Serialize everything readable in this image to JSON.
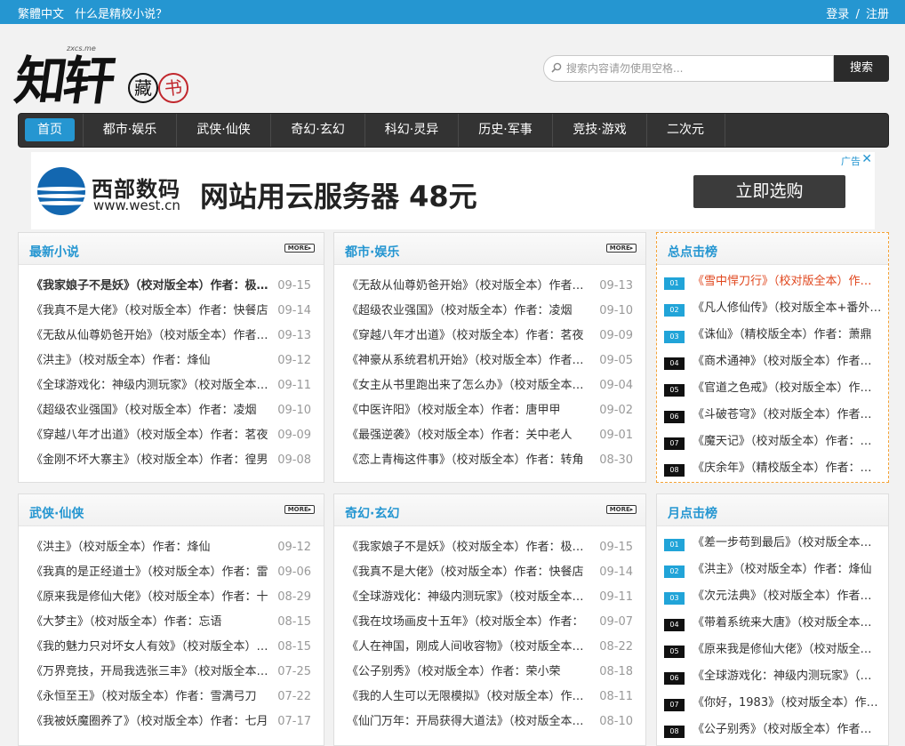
{
  "topbar": {
    "traditional": "繁體中文",
    "about": "什么是精校小说？",
    "login": "登录",
    "slash": "/",
    "register": "注册"
  },
  "logo": {
    "main": "知轩",
    "sub": "zxcs.me",
    "stamp1": "藏",
    "stamp2": "书"
  },
  "search": {
    "placeholder": "搜索内容请勿使用空格...",
    "button": "搜索"
  },
  "nav": [
    "首页",
    "都市·娱乐",
    "武侠·仙侠",
    "奇幻·玄幻",
    "科幻·灵异",
    "历史·军事",
    "竞技·游戏",
    "二次元"
  ],
  "ad": {
    "brand": "西部数码",
    "domain": "www.west.cn",
    "slogan": "网站用云服务器 48元",
    "cta": "立即选购",
    "tag": "广告",
    "close": "✕"
  },
  "more_label": "MORE▸",
  "panels": [
    {
      "title": "最新小说",
      "rows": [
        {
          "t": "《我家娘子不是妖》（校对版全本）作者：极品妖孽",
          "d": "09-15",
          "bold": true
        },
        {
          "t": "《我真不是大佬》（校对版全本）作者：快餐店",
          "d": "09-14"
        },
        {
          "t": "《无敌从仙尊奶爸开始》（校对版全本）作者：雪洛",
          "d": "09-13"
        },
        {
          "t": "《洪主》（校对版全本）作者：烽仙",
          "d": "09-12"
        },
        {
          "t": "《全球游戏化：神级内测玩家》（校对版全本）作者",
          "d": "09-11"
        },
        {
          "t": "《超级农业强国》（校对版全本）作者：凌烟",
          "d": "09-10"
        },
        {
          "t": "《穿越八年才出道》（校对版全本）作者：茗夜",
          "d": "09-09"
        },
        {
          "t": "《金刚不坏大寨主》（校对版全本）作者：徨男",
          "d": "09-08"
        }
      ]
    },
    {
      "title": "都市·娱乐",
      "rows": [
        {
          "t": "《无敌从仙尊奶爸开始》（校对版全本）作者：雪洛",
          "d": "09-13"
        },
        {
          "t": "《超级农业强国》（校对版全本）作者：凌烟",
          "d": "09-10"
        },
        {
          "t": "《穿越八年才出道》（校对版全本）作者：茗夜",
          "d": "09-09"
        },
        {
          "t": "《神豪从系统君机开始》（校对版全本）作者：文",
          "d": "09-05"
        },
        {
          "t": "《女主从书里跑出来了怎么办》（校对版全本）作者",
          "d": "09-04"
        },
        {
          "t": "《中医许阳》（校对版全本）作者：唐甲甲",
          "d": "09-02"
        },
        {
          "t": "《最强逆袭》（校对版全本）作者：关中老人",
          "d": "09-01"
        },
        {
          "t": "《恋上青梅这件事》（校对版全本）作者：转角",
          "d": "08-30"
        }
      ]
    },
    {
      "title": "武侠·仙侠",
      "rows": [
        {
          "t": "《洪主》（校对版全本）作者：烽仙",
          "d": "09-12"
        },
        {
          "t": "《我真的是正经道士》（校对版全本）作者：雷",
          "d": "09-06"
        },
        {
          "t": "《原来我是修仙大佬》（校对版全本）作者：十",
          "d": "08-29"
        },
        {
          "t": "《大梦主》（校对版全本）作者：忘语",
          "d": "08-15"
        },
        {
          "t": "《我的魅力只对坏女人有效》（校对版全本）作者",
          "d": "08-15"
        },
        {
          "t": "《万界竞技，开局我选张三丰》（校对版全本）作者",
          "d": "07-25"
        },
        {
          "t": "《永恒至王》（校对版全本）作者：雪满弓刀",
          "d": "07-22"
        },
        {
          "t": "《我被妖魔圈养了》（校对版全本）作者：七月",
          "d": "07-17"
        }
      ]
    },
    {
      "title": "奇幻·玄幻",
      "rows": [
        {
          "t": "《我家娘子不是妖》（校对版全本）作者：极品妖孽",
          "d": "09-15"
        },
        {
          "t": "《我真不是大佬》（校对版全本）作者：快餐店",
          "d": "09-14"
        },
        {
          "t": "《全球游戏化：神级内测玩家》（校对版全本）作者",
          "d": "09-11"
        },
        {
          "t": "《我在坟场画皮十五年》（校对版全本）作者：",
          "d": "09-07"
        },
        {
          "t": "《人在神国，刚成人间收容物》（校对版全本）作者",
          "d": "08-22"
        },
        {
          "t": "《公子别秀》（校对版全本）作者：荣小荣",
          "d": "08-18"
        },
        {
          "t": "《我的人生可以无限模拟》（校对版全本）作者：",
          "d": "08-11"
        },
        {
          "t": "《仙门万年：开局获得大道法》（校对版全本）作者",
          "d": "08-10"
        }
      ]
    }
  ],
  "ranks": [
    {
      "title": "总点击榜",
      "rows": [
        {
          "n": "01",
          "t": "《雪中悍刀行》（校对版全本）作者：烽火戏诸侯",
          "red": true
        },
        {
          "n": "02",
          "t": "《凡人修仙传》（校对版全本+番外）作者：忘语"
        },
        {
          "n": "03",
          "t": "《诛仙》（精校版全本）作者：萧鼎"
        },
        {
          "n": "04",
          "t": "《商术通神》（校对版全本）作者：三戒大师"
        },
        {
          "n": "05",
          "t": "《官道之色戒》（校对版全本）作者：钓人的鱼"
        },
        {
          "n": "06",
          "t": "《斗破苍穹》（校对版全本）作者：天蚕土豆"
        },
        {
          "n": "07",
          "t": "《魔天记》（校对版全本）作者：忘语"
        },
        {
          "n": "08",
          "t": "《庆余年》（精校版全本）作者：猫腻"
        }
      ]
    },
    {
      "title": "月点击榜",
      "rows": [
        {
          "n": "01",
          "t": "《差一步苟到最后》（校对版全本）作者："
        },
        {
          "n": "02",
          "t": "《洪主》（校对版全本）作者：烽仙"
        },
        {
          "n": "03",
          "t": "《次元法典》（校对版全本）作者：西贝猫"
        },
        {
          "n": "04",
          "t": "《带着系统来大唐》（校对版全本）作者"
        },
        {
          "n": "05",
          "t": "《原来我是修仙大佬》（校对版全本）作者"
        },
        {
          "n": "06",
          "t": "《全球游戏化：神级内测玩家》（校对版全本）"
        },
        {
          "n": "07",
          "t": "《你好，1983》（校对版全本）作者："
        },
        {
          "n": "08",
          "t": "《公子别秀》（校对版全本）作者：荣小荣"
        }
      ]
    }
  ]
}
